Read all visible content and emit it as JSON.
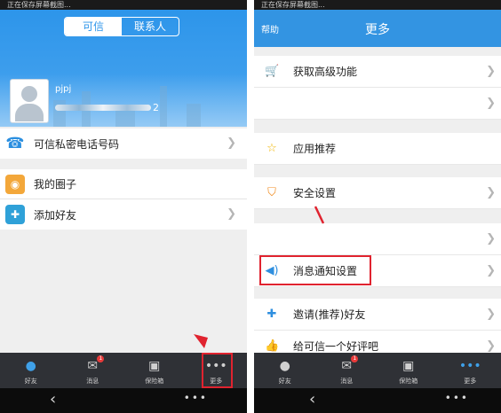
{
  "left": {
    "status_text": "正在保存屏幕截图...",
    "tabs": {
      "active": "可信",
      "inactive": "联系人"
    },
    "profile": {
      "name": "pjpj",
      "id_suffix": "2"
    },
    "rows": [
      {
        "label": "可信私密电话号码",
        "icon": "phone-icon"
      },
      {
        "label": "我的圈子",
        "icon": "circle-icon"
      },
      {
        "label": "添加好友",
        "icon": "add-user-icon"
      }
    ]
  },
  "right": {
    "status_text": "正在保存屏幕截图...",
    "help_label": "帮助",
    "title": "更多",
    "rows": [
      {
        "label": "获取高级功能",
        "icon": "cart-icon"
      },
      {
        "label": "",
        "icon": ""
      },
      {
        "label": "应用推荐",
        "icon": "star-icon"
      },
      {
        "label": "安全设置",
        "icon": "shield-icon"
      },
      {
        "label": "",
        "icon": ""
      },
      {
        "label": "消息通知设置",
        "icon": "speaker-icon"
      },
      {
        "label": "邀请(推荐)好友",
        "icon": "invite-icon"
      },
      {
        "label": "给可信一个好评吧",
        "icon": "thumbs-up-icon"
      }
    ]
  },
  "tabbar": {
    "items": [
      {
        "label": "好友",
        "icon": "person-icon"
      },
      {
        "label": "消息",
        "icon": "chat-icon",
        "badge": "1"
      },
      {
        "label": "保险箱",
        "icon": "safe-icon"
      },
      {
        "label": "更多",
        "icon": "more-icon"
      }
    ]
  },
  "colors": {
    "header_blue": "#3394e2",
    "tab_active": "#2f9be6",
    "highlight_red": "#e0232f"
  }
}
